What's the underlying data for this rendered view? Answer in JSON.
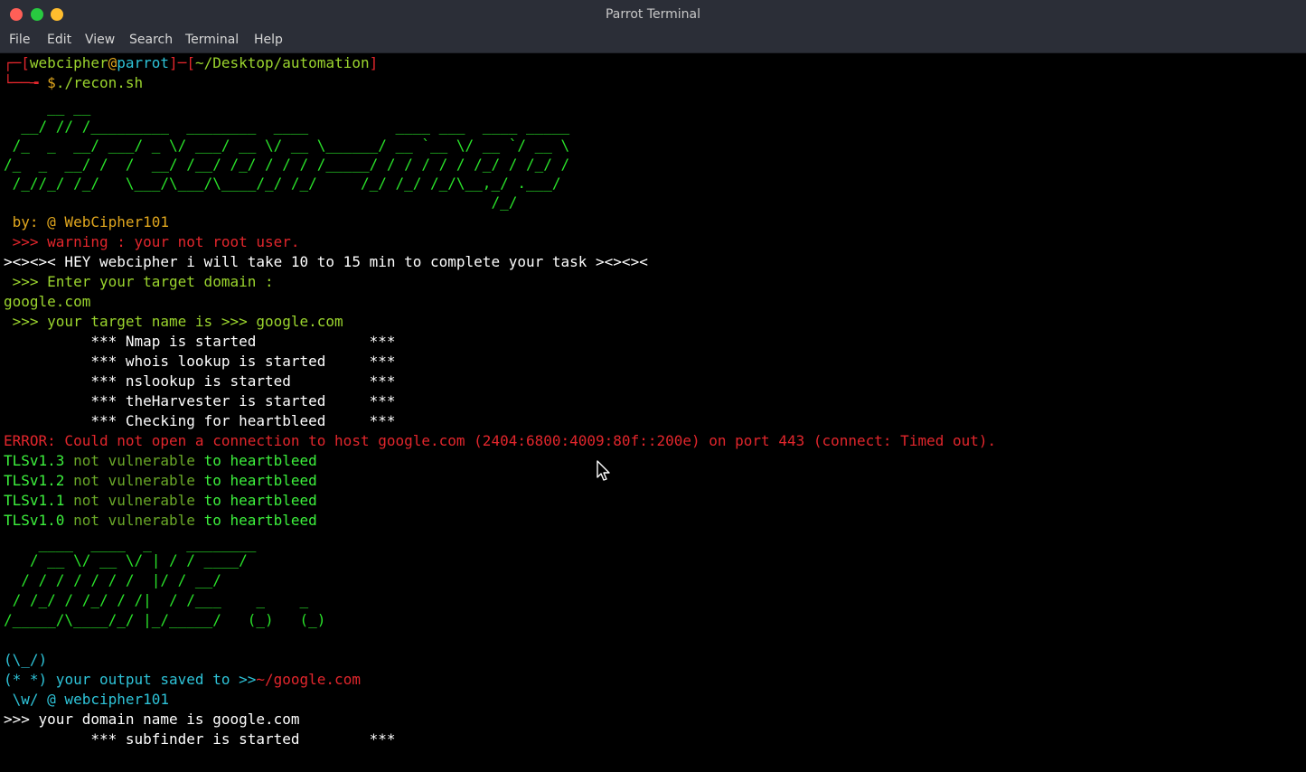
{
  "window": {
    "title": "Parrot Terminal"
  },
  "menu": [
    "File",
    "Edit",
    "View",
    "Search",
    "Terminal",
    "Help"
  ],
  "colors": {
    "background": "#000000",
    "titlebar": "#2b2e37",
    "prompt_red": "#e2262c",
    "ascii_green": "#2ae32a",
    "text_lime": "#9bd52e",
    "text_yellow": "#e1a71e",
    "text_cyan": "#2ec3d8"
  },
  "prompt": {
    "corner_top": "┌─",
    "bracket_open": "[",
    "user": "webcipher",
    "at": "@",
    "host": "parrot",
    "bracket_mid": "]─[",
    "path": "~/Desktop/automation",
    "bracket_close": "]",
    "corner_bottom": "└──╼ ",
    "dollar": "$",
    "command": "./recon.sh"
  },
  "banner1": [
    "     __ __",
    "  __/ // /_________  ________  ____          ____ ___  ____ _____",
    " /_  _  __/ ___/ _ \\/ ___/ __ \\/ __ \\______/ __ `__ \\/ __ `/ __ \\",
    "/_  _  __/ /  /  __/ /__/ /_/ / / / /_____/ / / / / / /_/ / /_/ /",
    " /_//_/ /_/   \\___/\\___/\\____/_/ /_/     /_/ /_/ /_/\\__,_/ .___/",
    "                                                        /_/"
  ],
  "byline": " by: @ WebCipher101",
  "warning": " >>> warning : your not root user.",
  "hey": "><><>< HEY webcipher i will take 10 to 15 min to complete your task ><><><",
  "enter_target": " >>> Enter your target domain :",
  "target_input": "google.com",
  "target_name_line": " >>> your target name is >>> google.com",
  "tasks": [
    "          *** Nmap is started             ***",
    "          *** whois lookup is started     ***",
    "          *** nslookup is started         ***",
    "          *** theHarvester is started     ***",
    "          *** Checking for heartbleed     ***"
  ],
  "error": "ERROR: Could not open a connection to host google.com (2404:6800:4009:80f::200e) on port 443 (connect: Timed out).",
  "tls_results": [
    {
      "proto": "TLSv1.3",
      "status": " not vulnerable",
      "to": " to",
      "vuln": " heartbleed"
    },
    {
      "proto": "TLSv1.2",
      "status": " not vulnerable",
      "to": " to",
      "vuln": " heartbleed"
    },
    {
      "proto": "TLSv1.1",
      "status": " not vulnerable",
      "to": " to",
      "vuln": " heartbleed"
    },
    {
      "proto": "TLSv1.0",
      "status": " not vulnerable",
      "to": " to",
      "vuln": " heartbleed"
    }
  ],
  "banner2": [
    "    ____  ____  _    ________",
    "   / __ \\/ __ \\/ | / / ____/",
    "  / / / / / / /  |/ / __/",
    " / /_/ / /_/ / /|  / /___    _    _",
    "/_____/\\____/_/ |_/_____/   (_)   (_)"
  ],
  "bunny": {
    "ears": "(\\_/)",
    "face": "(* *)",
    "output_text": " your output saved to >>",
    "output_path": "~/google.com",
    "paws": " \\w/ @ webcipher101"
  },
  "domain_line": ">>> your domain name is google.com",
  "subfinder": "          *** subfinder is started        ***"
}
